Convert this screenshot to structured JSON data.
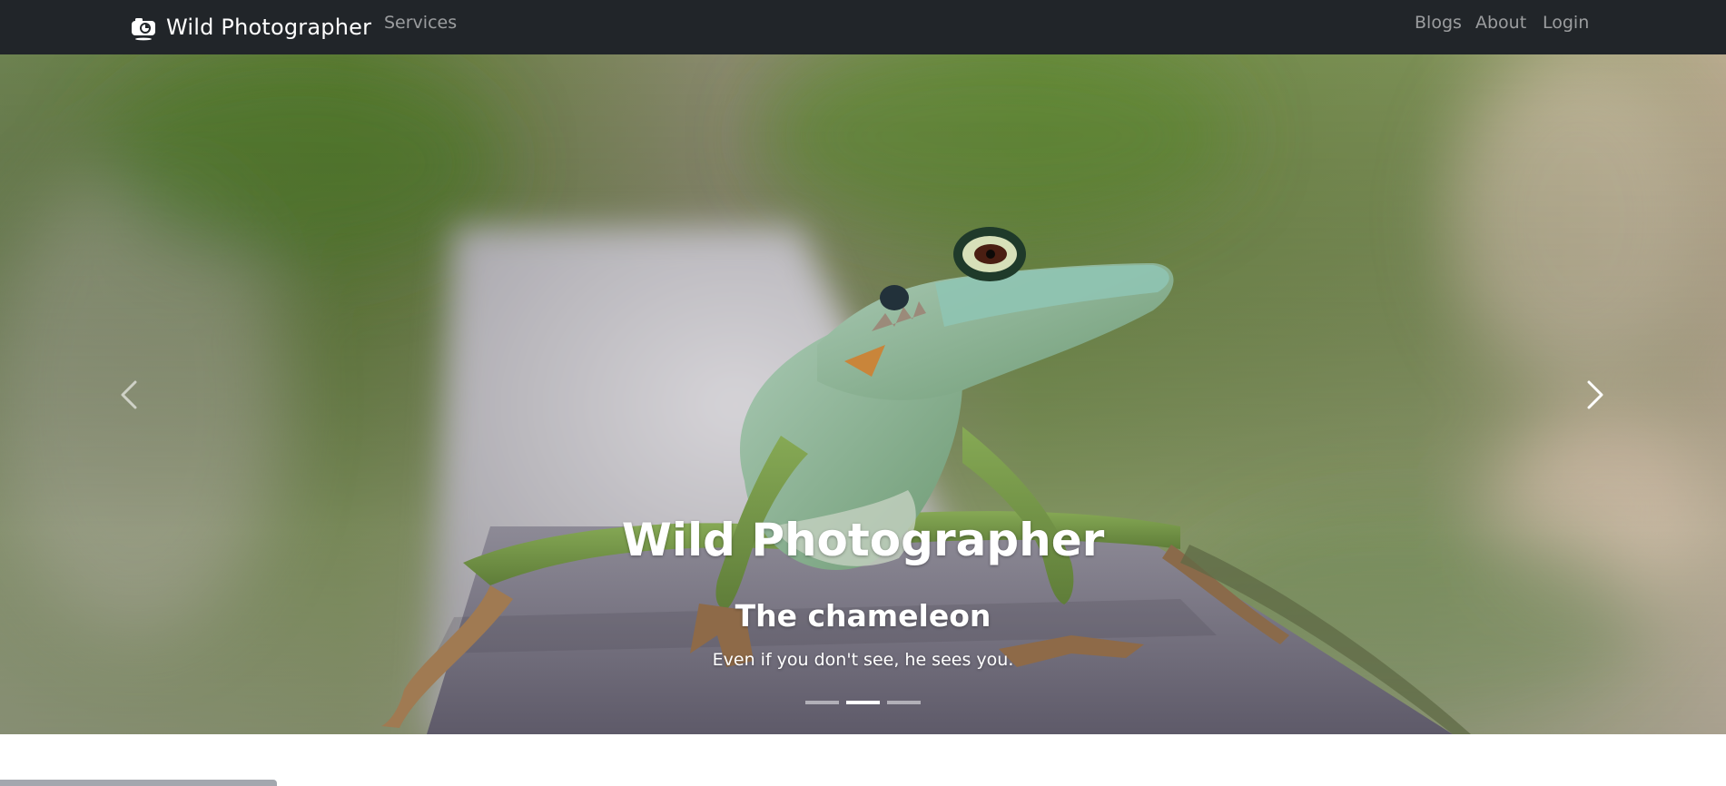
{
  "navbar": {
    "brand_label": "Wild Photographer",
    "brand_icon": "camera-icon",
    "links": {
      "services": "Services",
      "blogs": "Blogs",
      "about": "About",
      "login": "Login"
    },
    "background": "#212529"
  },
  "carousel": {
    "caption_title": "Wild Photographer",
    "caption_subtitle": "The chameleon",
    "caption_text": "Even if you don't see, he sees you.",
    "prev_icon": "chevron-left-icon",
    "next_icon": "chevron-right-icon",
    "slide_count": 3,
    "active_slide": 2
  }
}
